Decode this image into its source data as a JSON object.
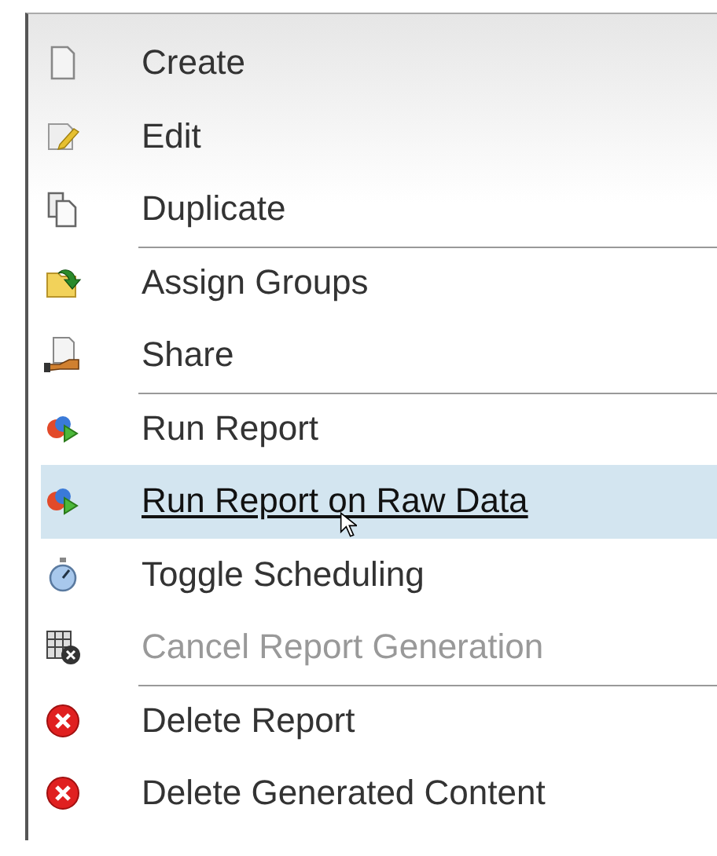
{
  "menu": {
    "groups": [
      {
        "items": [
          {
            "label": "Create",
            "selected": false,
            "disabled": false
          },
          {
            "label": "Edit",
            "selected": false,
            "disabled": false
          },
          {
            "label": "Duplicate",
            "selected": false,
            "disabled": false
          }
        ]
      },
      {
        "items": [
          {
            "label": "Assign Groups",
            "selected": false,
            "disabled": false
          },
          {
            "label": "Share",
            "selected": false,
            "disabled": false
          }
        ]
      },
      {
        "items": [
          {
            "label": "Run Report",
            "selected": false,
            "disabled": false
          },
          {
            "label": "Run Report on Raw Data",
            "selected": true,
            "disabled": false
          },
          {
            "label": "Toggle Scheduling",
            "selected": false,
            "disabled": false
          },
          {
            "label": "Cancel Report Generation",
            "selected": false,
            "disabled": true
          }
        ]
      },
      {
        "items": [
          {
            "label": "Delete Report",
            "selected": false,
            "disabled": false
          },
          {
            "label": "Delete Generated Content",
            "selected": false,
            "disabled": false
          }
        ]
      }
    ]
  }
}
